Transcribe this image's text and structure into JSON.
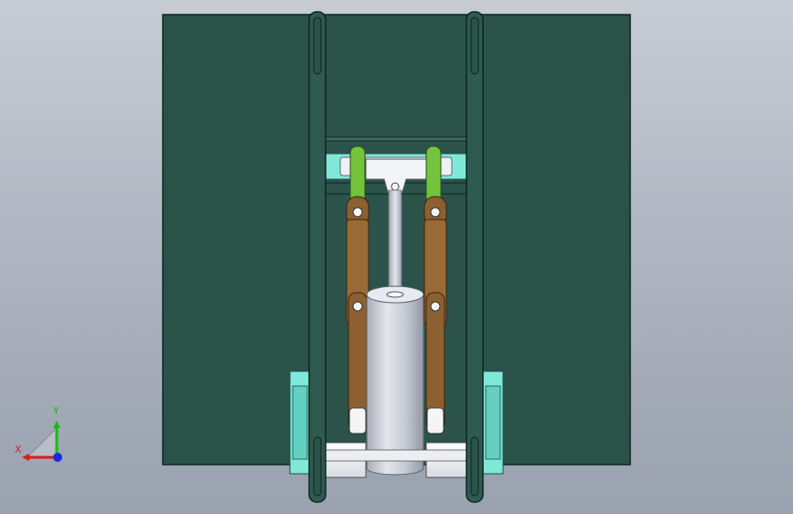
{
  "triad": {
    "x_label": "X",
    "y_label": "Y",
    "colors": {
      "x": "#d81c1c",
      "y": "#18b818",
      "z": "#1a2fd8"
    }
  },
  "colors": {
    "panel": "#2a5248",
    "panel_edge": "#0d2620",
    "cyan_part": "#7fe8d8",
    "link_brown": "#8c6030",
    "link_green": "#73c43c",
    "cylinder": "#c7cbd6",
    "block_white": "#f3f3f3"
  }
}
